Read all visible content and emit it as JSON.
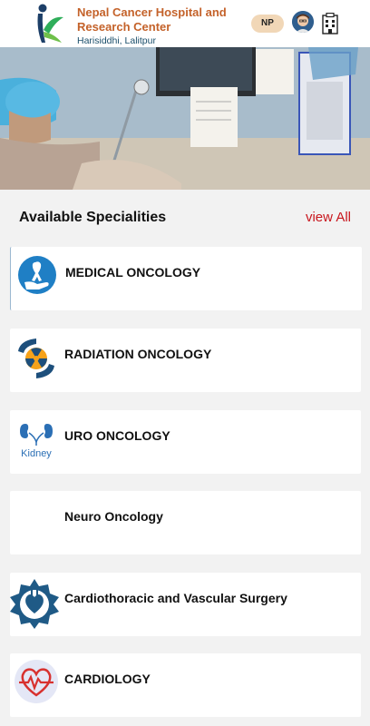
{
  "header": {
    "hospital_name": "Nepal Cancer Hospital and Research Center",
    "location": "Harisiddhi, Lalitpur",
    "language_button": "NP"
  },
  "section": {
    "title": "Available Specialities",
    "view_all": "view All"
  },
  "specialities": [
    {
      "label": "MEDICAL ONCOLOGY",
      "icon": "ribbon-hand-icon"
    },
    {
      "label": "RADIATION ONCOLOGY",
      "icon": "radiation-hands-icon"
    },
    {
      "label": "URO ONCOLOGY",
      "icon": "kidney-icon",
      "icon_text": "Kidney"
    },
    {
      "label": "Neuro Oncology",
      "icon": ""
    },
    {
      "label": "Cardiothoracic and Vascular Surgery",
      "icon": "heart-emblem-icon"
    },
    {
      "label": "CARDIOLOGY",
      "icon": "heartbeat-icon"
    }
  ],
  "colors": {
    "brand_orange": "#c4622a",
    "brand_blue": "#1b4f6b",
    "link_red": "#c8171e",
    "background": "#f2f2f2"
  }
}
